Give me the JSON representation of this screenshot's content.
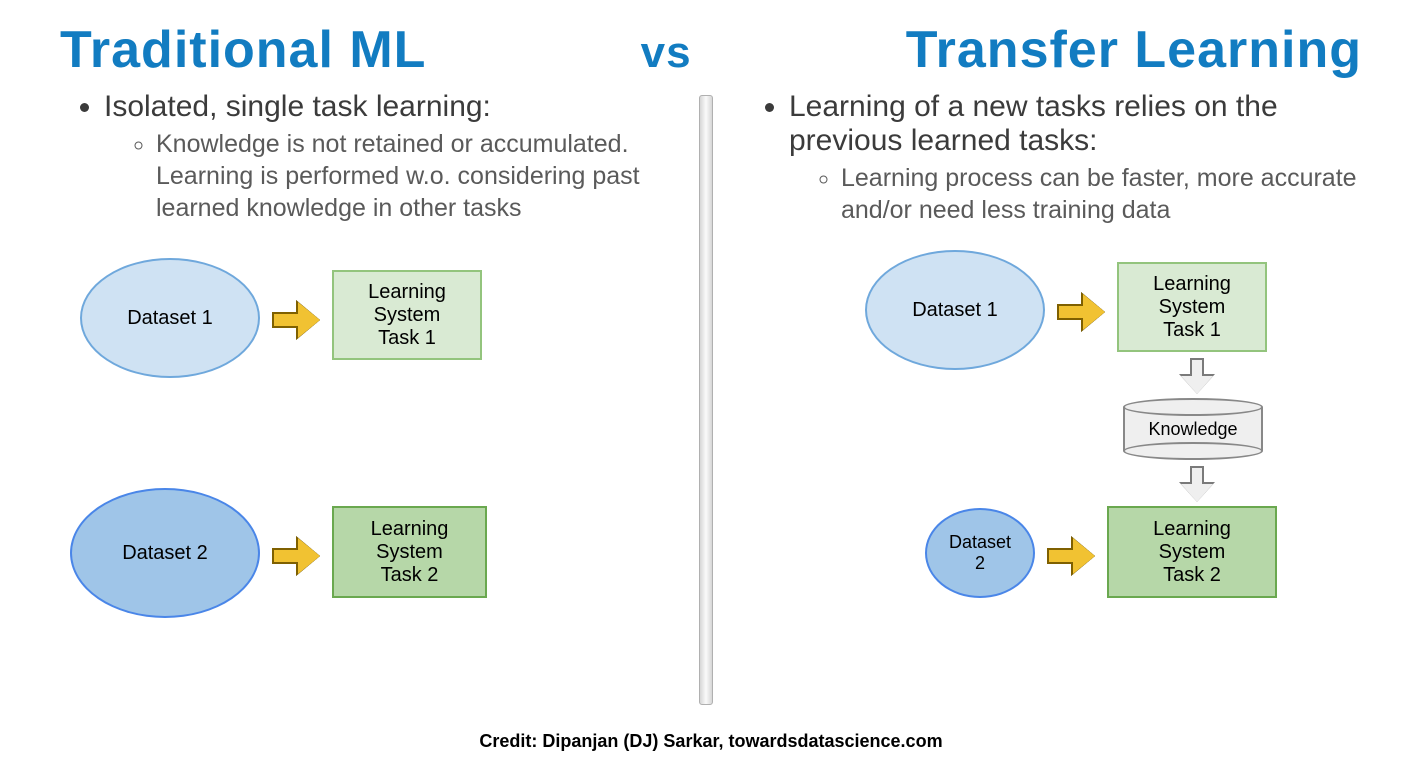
{
  "header": {
    "left": "Traditional ML",
    "vs": "vs",
    "right": "Transfer Learning"
  },
  "left": {
    "bullet": "Isolated, single task learning:",
    "sub": "Knowledge is not retained or accumulated. Learning is performed w.o. considering past learned knowledge in other tasks",
    "dataset1": "Dataset 1",
    "system1": "Learning\nSystem\nTask 1",
    "dataset2": "Dataset 2",
    "system2": "Learning\nSystem\nTask 2"
  },
  "right": {
    "bullet": "Learning of a new tasks relies on the previous learned tasks:",
    "sub": "Learning process can be faster, more accurate and/or need less training data",
    "dataset1": "Dataset 1",
    "system1": "Learning\nSystem\nTask 1",
    "knowledge": "Knowledge",
    "dataset2": "Dataset\n2",
    "system2": "Learning\nSystem\nTask 2"
  },
  "credit": "Credit: Dipanjan (DJ) Sarkar, towardsdatascience.com"
}
